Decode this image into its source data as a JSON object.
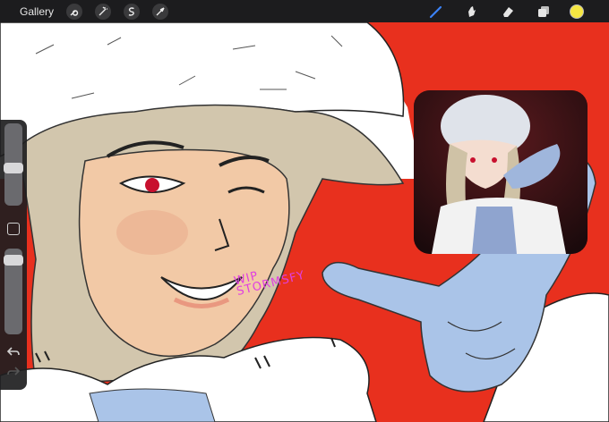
{
  "topbar": {
    "gallery_label": "Gallery",
    "left_tools": [
      {
        "name": "wrench-icon",
        "label": "Actions"
      },
      {
        "name": "magic-wand-icon",
        "label": "Adjustments"
      },
      {
        "name": "selection-icon",
        "label": "Selection"
      },
      {
        "name": "transform-icon",
        "label": "Transform"
      }
    ],
    "right_tools": [
      {
        "name": "brush-icon",
        "label": "Paint"
      },
      {
        "name": "smudge-icon",
        "label": "Smudge"
      },
      {
        "name": "eraser-icon",
        "label": "Erase"
      },
      {
        "name": "layers-icon",
        "label": "Layers"
      }
    ],
    "active_color": "#f5e642",
    "active_tool_color": "#3b82f6"
  },
  "sidebar": {
    "brush_size": 0.45,
    "opacity": 0.92
  },
  "canvas": {
    "background_color": "#e8301e",
    "watermark_line1": "WIP",
    "watermark_line2": "STORMSFY"
  },
  "colors": {
    "skin": "#f2c9a6",
    "hair": "#d2c6ad",
    "glove": "#aac4e8",
    "fur": "#ffffff",
    "eye": "#c8102e",
    "lips": "#e99880"
  }
}
